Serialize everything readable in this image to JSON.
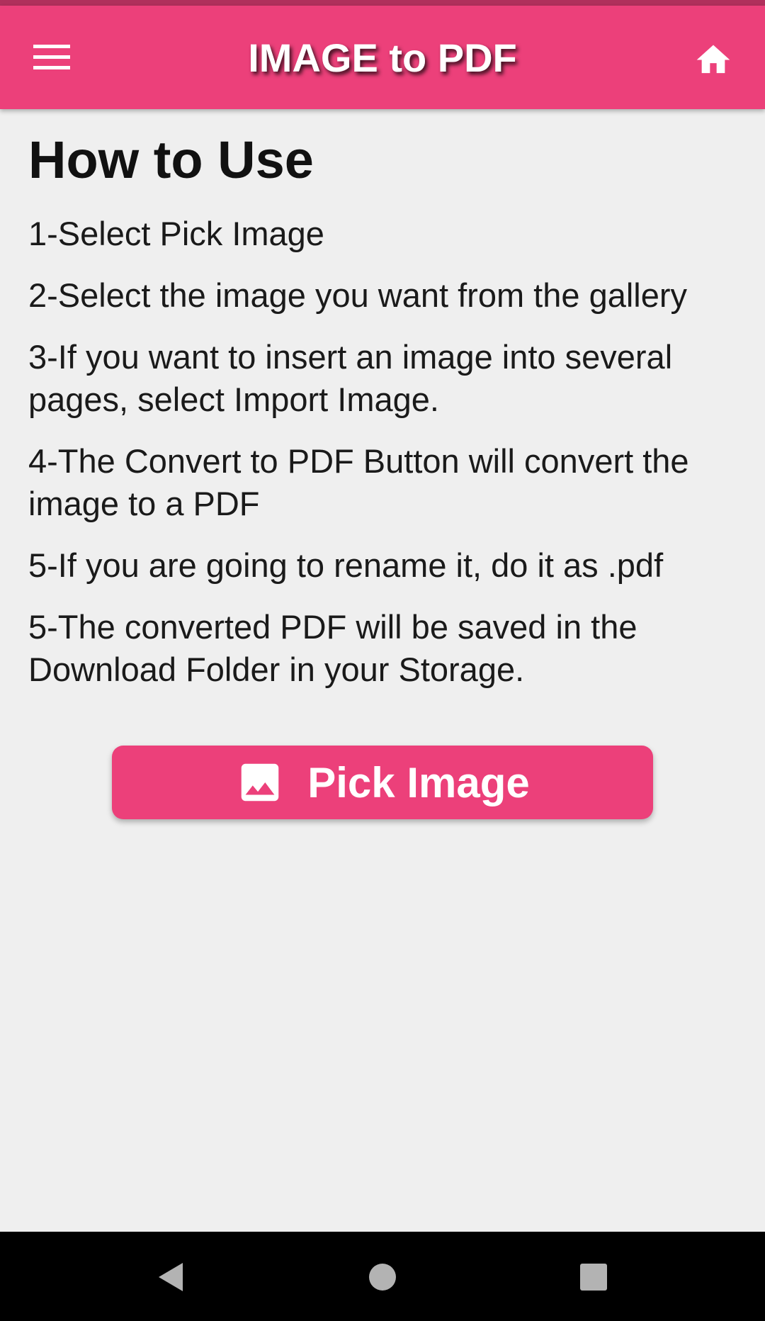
{
  "app_bar": {
    "title": "IMAGE to PDF",
    "menu_icon": "hamburger-menu-icon",
    "home_icon": "home-icon",
    "color": "#ec407a"
  },
  "content": {
    "heading": "How to Use",
    "steps": [
      "1-Select Pick Image",
      "2-Select the image you want from the gallery",
      "3-If you want to insert an image into several pages, select Import Image.",
      "4-The Convert to PDF Button will convert the image to a PDF",
      "5-If you are going to rename it, do it as .pdf",
      "5-The converted PDF will be saved in the Download Folder in your Storage."
    ]
  },
  "pick_button": {
    "label": "Pick Image",
    "icon": "image-icon"
  },
  "nav_bar": {
    "back_icon": "back-triangle-icon",
    "home_icon": "home-circle-icon",
    "recents_icon": "recents-square-icon"
  }
}
